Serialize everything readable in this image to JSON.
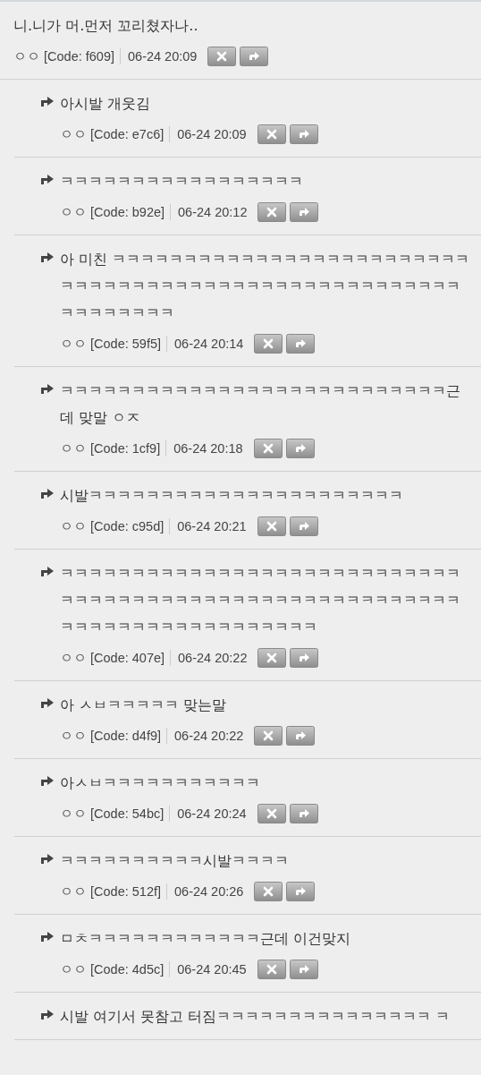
{
  "comment": {
    "text": "니.니가 머.먼저 꼬리쳤자나..",
    "author": "ㅇㅇ",
    "code": "[Code: f609]",
    "time": "06-24 20:09",
    "replies": [
      {
        "text": "아시발 개웃김",
        "author": "ㅇㅇ",
        "code": "[Code: e7c6]",
        "time": "06-24 20:09"
      },
      {
        "text": "ㅋㅋㅋㅋㅋㅋㅋㅋㅋㅋㅋㅋㅋㅋㅋㅋㅋ",
        "author": "ㅇㅇ",
        "code": "[Code: b92e]",
        "time": "06-24 20:12"
      },
      {
        "text": "아 미친 ㅋㅋㅋㅋㅋㅋㅋㅋㅋㅋㅋㅋㅋㅋㅋㅋㅋㅋㅋㅋㅋㅋㅋㅋㅋㅋㅋㅋㅋㅋㅋㅋㅋㅋㅋㅋㅋㅋㅋㅋㅋㅋㅋㅋㅋㅋㅋㅋㅋㅋㅋㅋㅋㅋㅋㅋㅋㅋㅋㅋㅋ",
        "author": "ㅇㅇ",
        "code": "[Code: 59f5]",
        "time": "06-24 20:14"
      },
      {
        "text": "ㅋㅋㅋㅋㅋㅋㅋㅋㅋㅋㅋㅋㅋㅋㅋㅋㅋㅋㅋㅋㅋㅋㅋㅋㅋㅋㅋ근데 맞말 ㅇㅈ",
        "author": "ㅇㅇ",
        "code": "[Code: 1cf9]",
        "time": "06-24 20:18"
      },
      {
        "text": "시발ㅋㅋㅋㅋㅋㅋㅋㅋㅋㅋㅋㅋㅋㅋㅋㅋㅋㅋㅋㅋㅋㅋ",
        "author": "ㅇㅇ",
        "code": "[Code: c95d]",
        "time": "06-24 20:21"
      },
      {
        "text": "ㅋㅋㅋㅋㅋㅋㅋㅋㅋㅋㅋㅋㅋㅋㅋㅋㅋㅋㅋㅋㅋㅋㅋㅋㅋㅋㅋㅋㅋㅋㅋㅋㅋㅋㅋㅋㅋㅋㅋㅋㅋㅋㅋㅋㅋㅋㅋㅋㅋㅋㅋㅋㅋㅋㅋㅋㅋㅋㅋㅋㅋㅋㅋㅋㅋㅋㅋㅋㅋㅋㅋㅋㅋㅋ",
        "author": "ㅇㅇ",
        "code": "[Code: 407e]",
        "time": "06-24 20:22"
      },
      {
        "text": "아 ㅅㅂㅋㅋㅋㅋㅋ 맞는말",
        "author": "ㅇㅇ",
        "code": "[Code: d4f9]",
        "time": "06-24 20:22"
      },
      {
        "text": "아ㅅㅂㅋㅋㅋㅋㅋㅋㅋㅋㅋㅋㅋ",
        "author": "ㅇㅇ",
        "code": "[Code: 54bc]",
        "time": "06-24 20:24"
      },
      {
        "text": "ㅋㅋㅋㅋㅋㅋㅋㅋㅋㅋ시발ㅋㅋㅋㅋ",
        "author": "ㅇㅇ",
        "code": "[Code: 512f]",
        "time": "06-24 20:26"
      },
      {
        "text": "ㅁㅊㅋㅋㅋㅋㅋㅋㅋㅋㅋㅋㅋㅋ근데 이건맞지",
        "author": "ㅇㅇ",
        "code": "[Code: 4d5c]",
        "time": "06-24 20:45"
      },
      {
        "text": "시발 여기서 못참고 터짐ㅋㅋㅋㅋㅋㅋㅋㅋㅋㅋㅋㅋㅋㅋㅋ ㅋ"
      }
    ]
  }
}
